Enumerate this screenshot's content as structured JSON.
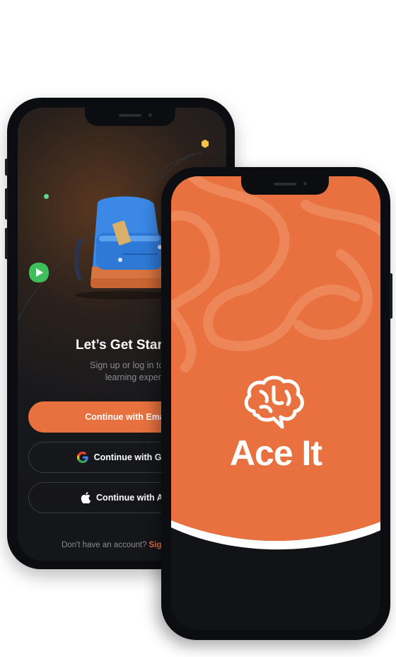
{
  "login_screen": {
    "headline": "Let’s Get Starte",
    "subtitle_line1": "Sign up or log in to have a b",
    "subtitle_line2": "learning experience!",
    "email_button": "Continue with Email",
    "google_button": "Continue with Goog",
    "apple_button": "Continue with App",
    "footer_prefix": "Don't have an account? ",
    "footer_link": "Sig"
  },
  "splash_screen": {
    "app_name": "Ace It"
  },
  "colors": {
    "accent": "#e8713f",
    "dark_bg": "#141519",
    "text_muted": "#8a8c93"
  },
  "icons": [
    "play-icon",
    "google-icon",
    "apple-icon",
    "brain-chat-icon",
    "backpack-illustration"
  ]
}
